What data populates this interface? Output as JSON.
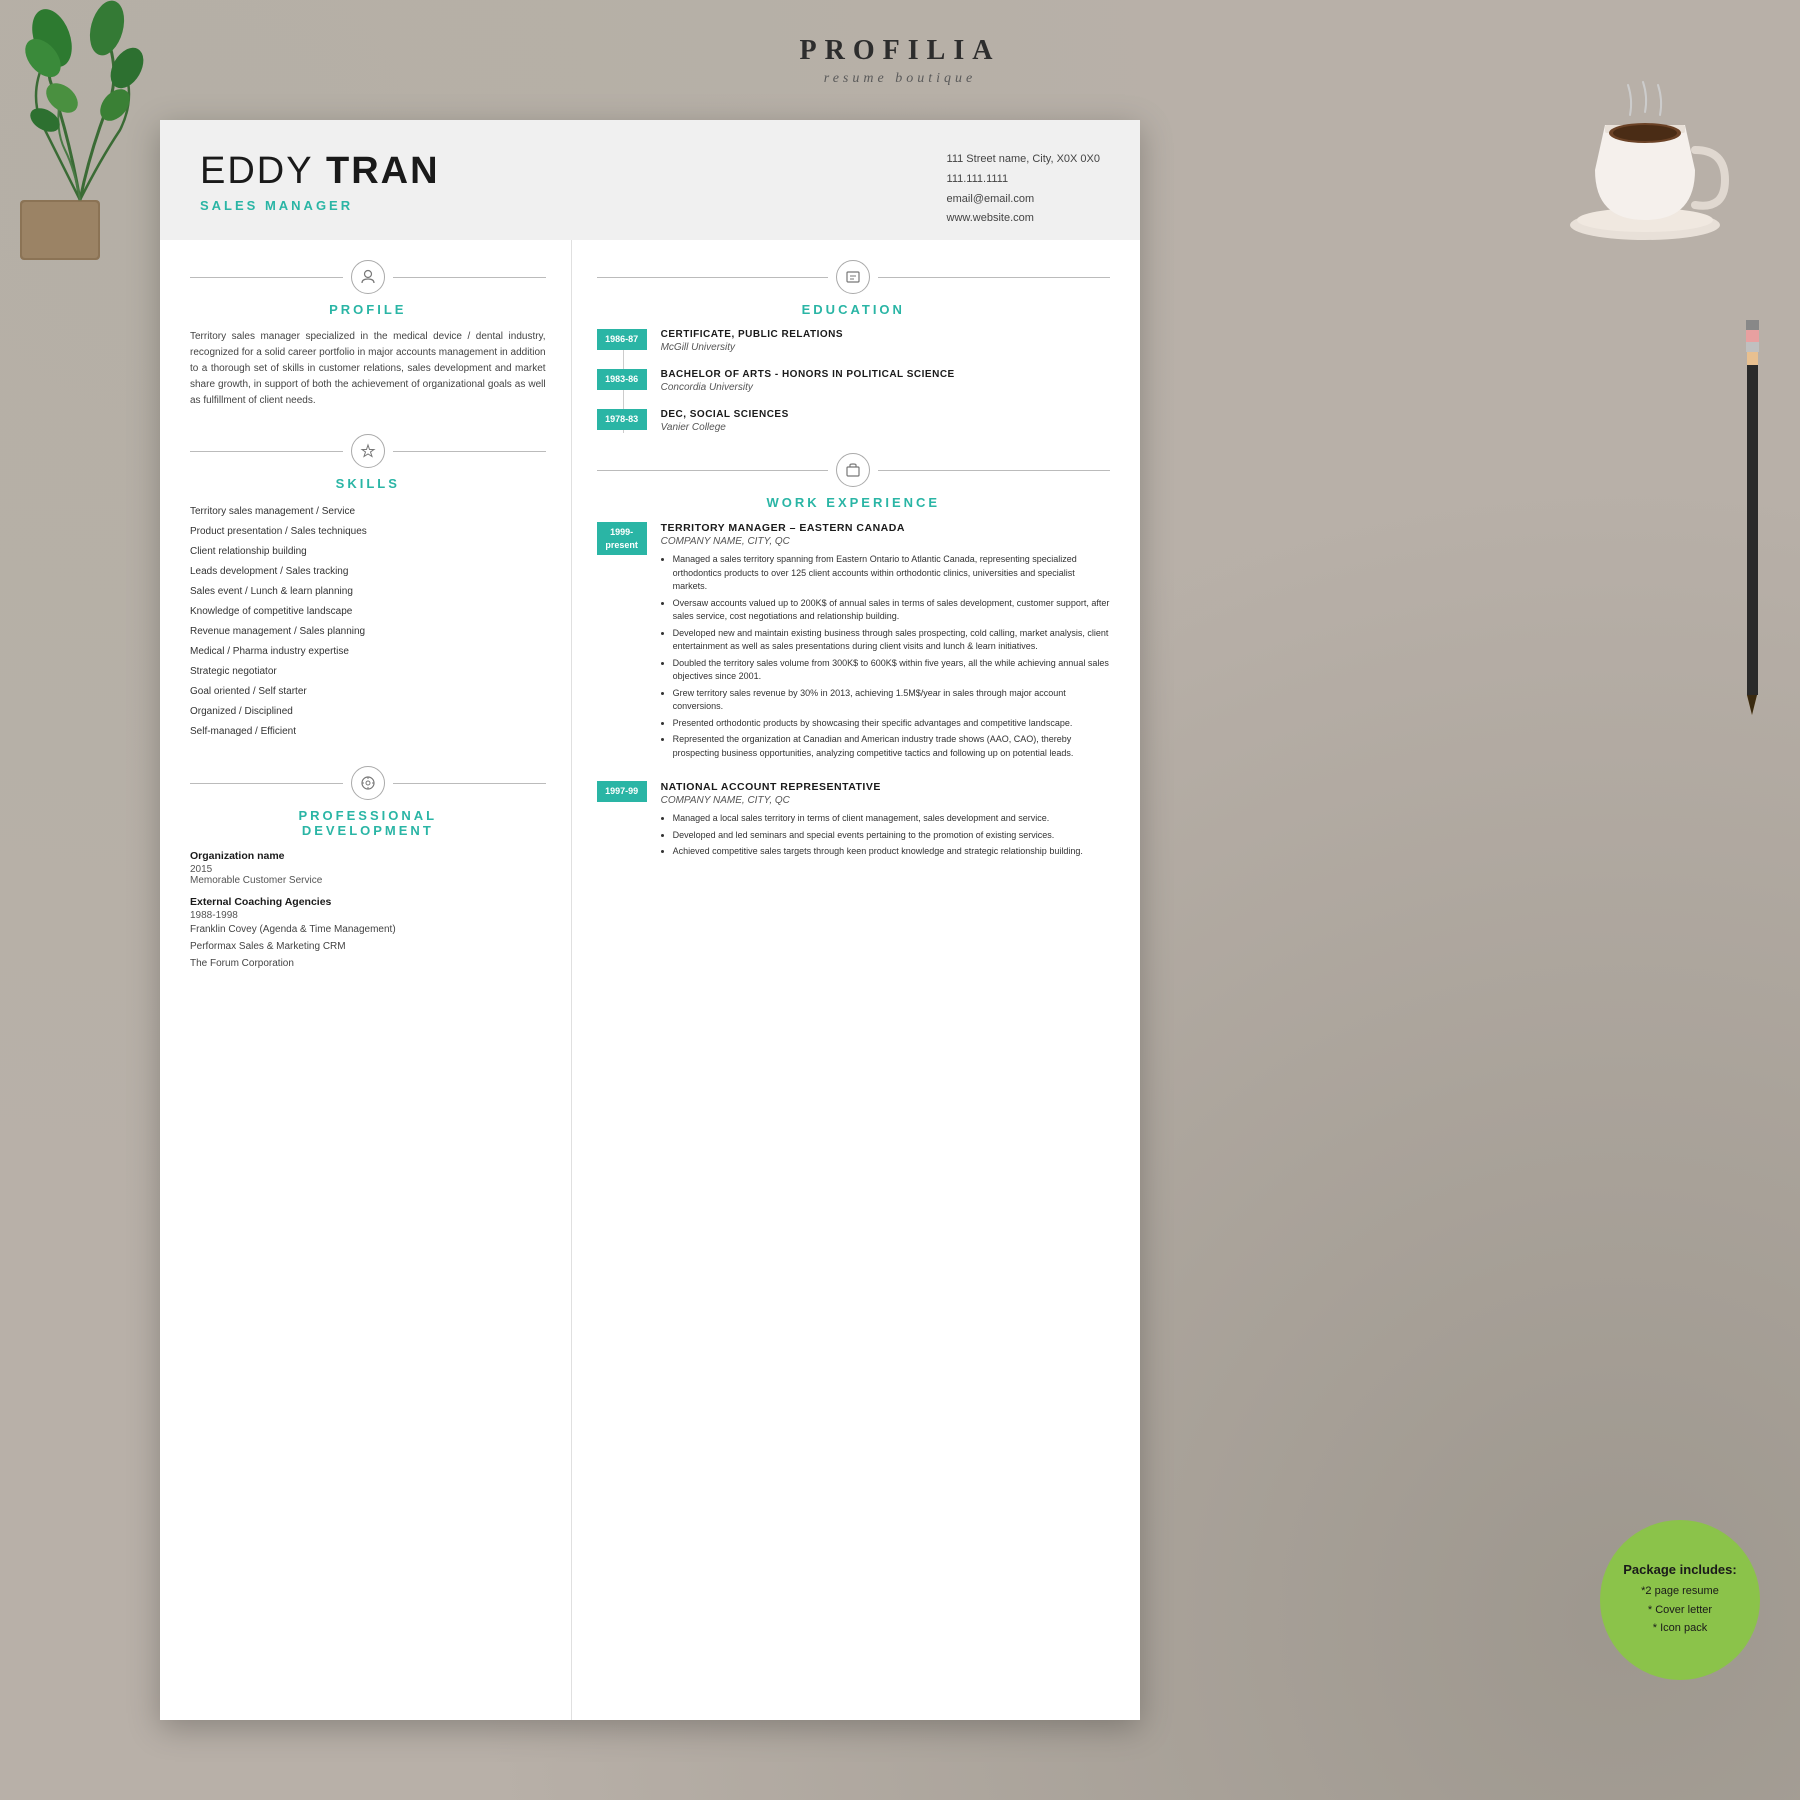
{
  "brand": {
    "name": "PROFILIA",
    "subtitle": "resume boutique"
  },
  "resume": {
    "header": {
      "first_name": "EDDY",
      "last_name": "TRAN",
      "job_title": "SALES MANAGER",
      "contact": {
        "address": "111 Street name, City, X0X 0X0",
        "phone": "111.111.1111",
        "email": "email@email.com",
        "website": "www.website.com"
      }
    },
    "profile": {
      "section_title": "PROFILE",
      "text": "Territory sales manager specialized in the medical device / dental industry, recognized for a solid career portfolio in major accounts management in addition to a thorough set of skills in customer relations, sales development and market share growth, in support of both the achievement of organizational goals as well as fulfillment of client needs."
    },
    "skills": {
      "section_title": "SKILLS",
      "items": [
        "Territory sales management / Service",
        "Product presentation / Sales techniques",
        "Client relationship building",
        "Leads development / Sales tracking",
        "Sales event / Lunch & learn planning",
        "Knowledge of competitive landscape",
        "Revenue management / Sales planning",
        "Medical / Pharma industry expertise",
        "Strategic negotiator",
        "Goal oriented / Self starter",
        "Organized / Disciplined",
        "Self-managed / Efficient"
      ]
    },
    "professional_development": {
      "section_title": "PROFESSIONAL DEVELOPMENT",
      "entries": [
        {
          "org": "Organization name",
          "year": "2015",
          "desc": "Memorable Customer Service"
        },
        {
          "org": "External Coaching Agencies",
          "year": "1988-1998",
          "items": [
            "Franklin Covey (Agenda & Time Management)",
            "Performax Sales & Marketing CRM",
            "The Forum Corporation"
          ]
        }
      ]
    },
    "education": {
      "section_title": "EDUCATION",
      "entries": [
        {
          "date": "1986-87",
          "degree": "CERTIFICATE, PUBLIC RELATIONS",
          "school": "McGill University"
        },
        {
          "date": "1983-86",
          "degree": "BACHELOR OF ARTS - HONORS IN POLITICAL SCIENCE",
          "school": "Concordia University"
        },
        {
          "date": "1978-83",
          "degree": "DEC, SOCIAL SCIENCES",
          "school": "Vanier College"
        }
      ]
    },
    "work_experience": {
      "section_title": "WORK EXPERIENCE",
      "jobs": [
        {
          "date": "1999-\npresent",
          "title": "TERRITORY MANAGER – EASTERN CANADA",
          "company": "COMPANY NAME, CITY, QC",
          "bullets": [
            "Managed a sales territory spanning from Eastern Ontario to Atlantic Canada, representing specialized orthodontics products to over 125 client accounts within orthodontic clinics, universities and specialist markets.",
            "Oversaw accounts valued up to 200K$ of annual sales in terms of sales development, customer support, after sales service, cost negotiations and relationship building.",
            "Developed new and maintain existing business through sales prospecting, cold calling, market analysis, client entertainment as well as sales presentations during client visits and lunch & learn initiatives.",
            "Doubled the territory sales volume from 300K$ to 600K$ within five years, all the while achieving annual sales objectives since 2001.",
            "Grew territory sales revenue by 30% in 2013, achieving 1.5M$/year in sales through major account conversions.",
            "Presented orthodontic products by showcasing their specific advantages and competitive landscape.",
            "Represented the organization at Canadian and American industry trade shows (AAO, CAO), thereby prospecting business opportunities, analyzing competitive tactics and following up on potential leads."
          ]
        },
        {
          "date": "1997-99",
          "title": "NATIONAL ACCOUNT REPRESENTATIVE",
          "company": "COMPANY NAME, CITY, QC",
          "bullets": [
            "Managed a local sales territory in terms of client management, sales development and service.",
            "Developed and led seminars and special events pertaining to the promotion of existing services.",
            "Achieved competitive sales targets through keen product knowledge and strategic relationship building."
          ]
        }
      ]
    }
  },
  "package": {
    "title": "Package includes:",
    "items": [
      "*2 page resume",
      "* Cover letter",
      "* Icon pack"
    ]
  }
}
